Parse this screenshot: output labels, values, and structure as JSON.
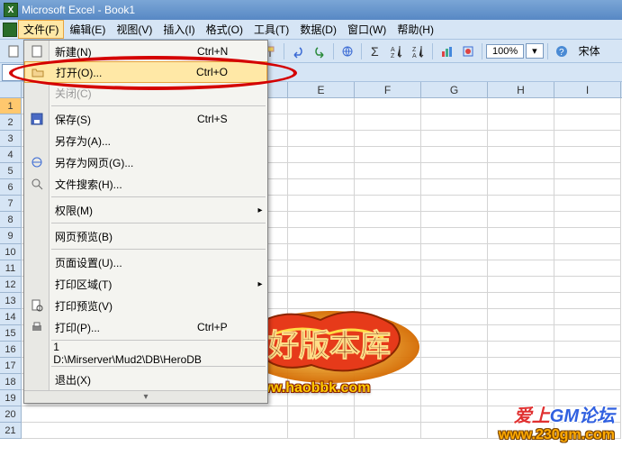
{
  "title": "Microsoft Excel - Book1",
  "menubar": {
    "file": "文件(F)",
    "edit": "编辑(E)",
    "view": "视图(V)",
    "insert": "插入(I)",
    "format": "格式(O)",
    "tools": "工具(T)",
    "data": "数据(D)",
    "window": "窗口(W)",
    "help": "帮助(H)"
  },
  "toolbar": {
    "zoom": "100%",
    "font_label": "宋体"
  },
  "namebox": "",
  "columns": [
    "E",
    "F",
    "G",
    "H",
    "I"
  ],
  "rows": [
    "1",
    "2",
    "3",
    "4",
    "5",
    "6",
    "7",
    "8",
    "9",
    "10",
    "11",
    "12",
    "13",
    "14",
    "15",
    "16",
    "17",
    "18",
    "19",
    "20",
    "21"
  ],
  "selected_row": "1",
  "dropdown": {
    "new": {
      "label": "新建(N)",
      "shortcut": "Ctrl+N"
    },
    "open": {
      "label": "打开(O)...",
      "shortcut": "Ctrl+O"
    },
    "close": {
      "label": "关闭(C)"
    },
    "save": {
      "label": "保存(S)",
      "shortcut": "Ctrl+S"
    },
    "save_as": {
      "label": "另存为(A)..."
    },
    "save_web": {
      "label": "另存为网页(G)..."
    },
    "file_search": {
      "label": "文件搜索(H)..."
    },
    "permission": {
      "label": "权限(M)"
    },
    "web_preview": {
      "label": "网页预览(B)"
    },
    "page_setup": {
      "label": "页面设置(U)..."
    },
    "print_area": {
      "label": "打印区域(T)"
    },
    "print_preview": {
      "label": "打印预览(V)"
    },
    "print": {
      "label": "打印(P)...",
      "shortcut": "Ctrl+P"
    },
    "recent1": {
      "label": "1 D:\\Mirserver\\Mud2\\DB\\HeroDB"
    },
    "exit": {
      "label": "退出(X)"
    }
  },
  "overlays": {
    "logo1_url": "www.haobbk.com",
    "logo2_text_a": "爱上",
    "logo2_text_b": "GM论坛",
    "logo2_url": "www.230gm.com"
  }
}
